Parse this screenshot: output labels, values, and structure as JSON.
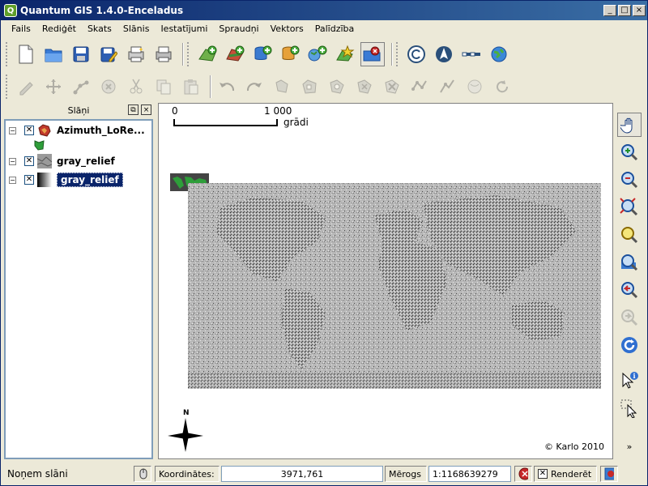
{
  "window": {
    "title": "Quantum GIS 1.4.0-Enceladus",
    "app_icon_letter": "Q",
    "controls": {
      "minimize": "_",
      "maximize": "□",
      "close": "×"
    }
  },
  "menu": [
    "Fails",
    "Rediģēt",
    "Skats",
    "Slānis",
    "Iestatījumi",
    "Spraudņi",
    "Vektors",
    "Palīdzība"
  ],
  "toolbar_file": [
    "new-project-icon",
    "open-project-icon",
    "save-project-icon",
    "save-as-icon",
    "new-print-composer-icon",
    "print-icon"
  ],
  "toolbar_layers": [
    "add-vector-layer-icon",
    "add-raster-layer-icon",
    "add-postgis-layer-icon",
    "add-spatialite-layer-icon",
    "add-wms-layer-icon",
    "new-shapefile-icon",
    "remove-layer-icon"
  ],
  "toolbar_decorations": [
    "copyright-label-icon",
    "north-arrow-icon",
    "scale-bar-icon",
    "globe-icon"
  ],
  "toolbar_edit": [
    "toggle-editing-icon",
    "capture-point-icon",
    "move-feature-icon",
    "node-tool-icon",
    "delete-selected-icon",
    "cut-features-icon",
    "copy-features-icon",
    "paste-features-icon",
    "undo-icon",
    "redo-icon",
    "simplify-feature-icon",
    "add-ring-icon",
    "add-island-icon",
    "delete-ring-icon",
    "delete-part-icon",
    "reshape-features-icon",
    "split-features-icon",
    "merge-features-icon",
    "node-snap-icon",
    "rotate-point-symbols-icon"
  ],
  "legend": {
    "title": "Slāņi",
    "layers": [
      {
        "name": "Azimuth_LoRe...",
        "checked": true,
        "expanded": true,
        "selected": false
      },
      {
        "name": "gray_relief",
        "checked": true,
        "expanded": true,
        "selected": false
      },
      {
        "name": "gray_relief",
        "checked": true,
        "expanded": false,
        "selected": true
      }
    ]
  },
  "map": {
    "scale_bar": {
      "left_label": "0",
      "right_label": "1 000",
      "unit": "grādi"
    },
    "north_label": "N",
    "copyright": "© Karlo 2010"
  },
  "right_toolbar": [
    "pan-icon",
    "zoom-in-icon",
    "zoom-out-icon",
    "zoom-full-icon",
    "zoom-to-selection-icon",
    "zoom-to-layer-icon",
    "zoom-last-icon",
    "zoom-next-icon",
    "refresh-icon",
    "identify-icon",
    "select-features-icon"
  ],
  "status": {
    "message": "Noņem slāni",
    "coord_label": "Koordinātes:",
    "coord_value": "3971,761",
    "scale_label": "Mērogs",
    "scale_value": "1:1168639279",
    "render_label": "Renderēt",
    "render_checked": true
  },
  "colors": {
    "titlebar": "#0a246a",
    "selection": "#0a246a",
    "panel_border": "#7f9db9"
  }
}
